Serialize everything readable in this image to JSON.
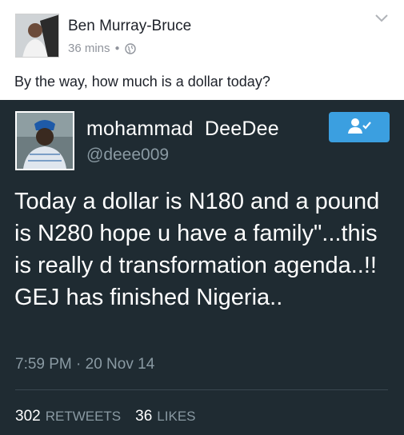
{
  "facebook": {
    "author": "Ben Murray-Bruce",
    "time": "36 mins",
    "privacy_icon": "globe-icon",
    "menu_icon": "chevron-down-icon",
    "post_text": "By the way, how much is a dollar today?"
  },
  "tweet": {
    "name": "mohammad  DeeDee",
    "handle": "@deee009",
    "follow_icon": "follow-user-icon",
    "text": "Today a dollar is N180 and a pound is N280 hope u have a family\"...this is really d transformation agenda..!! GEJ has finished Nigeria..",
    "timestamp": "7:59 PM · 20 Nov 14",
    "retweets_count": "302",
    "retweets_label": "RETWEETS",
    "likes_count": "36",
    "likes_label": "LIKES"
  },
  "colors": {
    "tweet_background": "#1f2b32",
    "follow_button": "#3b9fe0",
    "muted_text": "#8a9aa3"
  }
}
